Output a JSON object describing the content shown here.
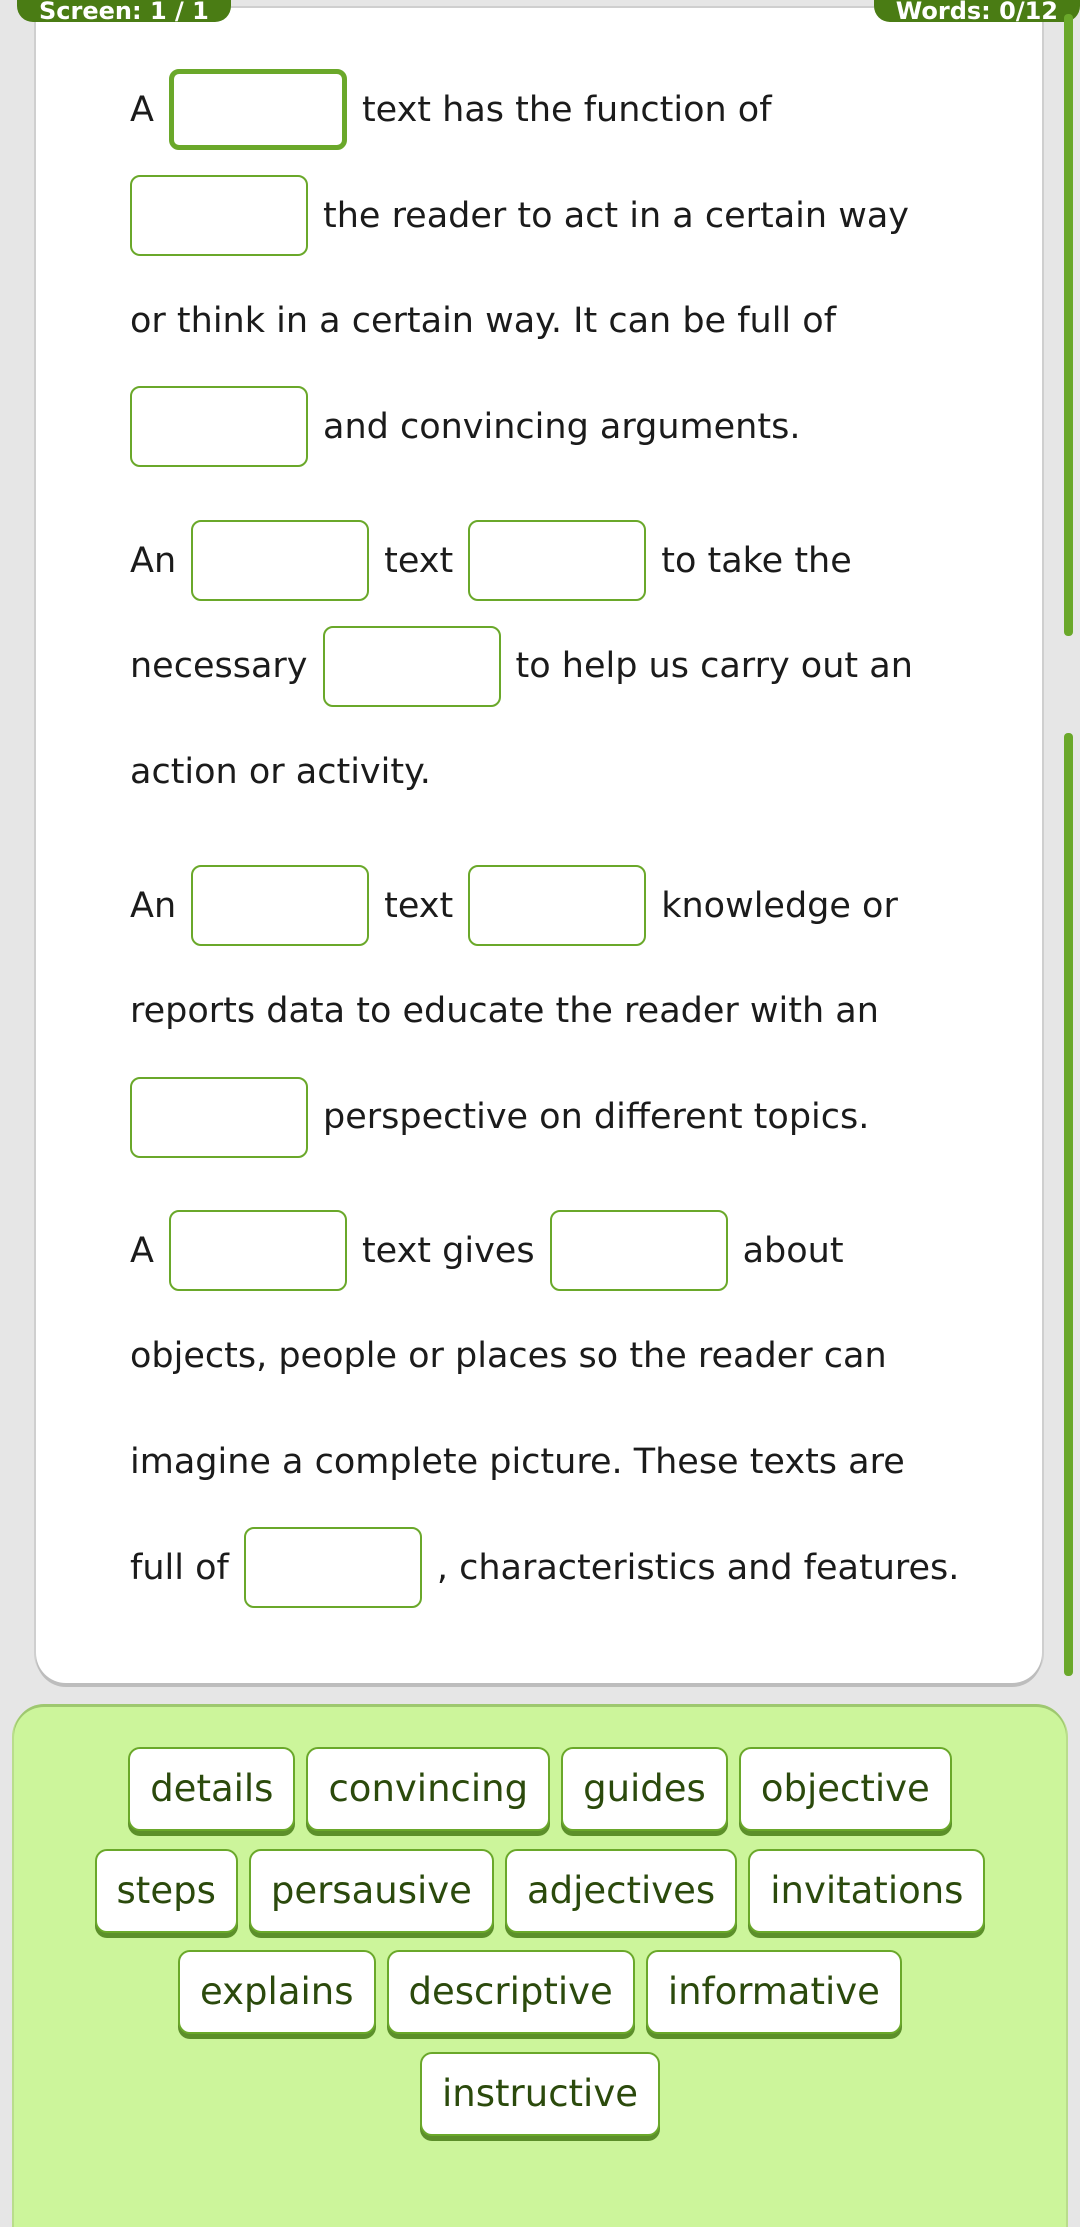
{
  "header": {
    "screen_label": "Screen: 1 / 1",
    "words_label": "Words: 0/12"
  },
  "passage": {
    "lines": [
      {
        "gap": false,
        "segs": [
          {
            "t": "A"
          },
          {
            "blank": true,
            "active": true
          },
          {
            "t": "text has the function of"
          }
        ]
      },
      {
        "gap": false,
        "segs": [
          {
            "blank": true
          },
          {
            "t": "the reader to act in a certain way"
          }
        ]
      },
      {
        "gap": false,
        "segs": [
          {
            "t": "or think in a certain way. It can be full of"
          }
        ]
      },
      {
        "gap": false,
        "segs": [
          {
            "blank": true
          },
          {
            "t": "and convincing arguments."
          }
        ]
      },
      {
        "gap": true,
        "segs": [
          {
            "t": "An"
          },
          {
            "blank": true
          },
          {
            "t": "text"
          },
          {
            "blank": true
          },
          {
            "t": "to take the"
          }
        ]
      },
      {
        "gap": false,
        "segs": [
          {
            "t": "necessary"
          },
          {
            "blank": true
          },
          {
            "t": "to help us carry out an"
          }
        ]
      },
      {
        "gap": false,
        "segs": [
          {
            "t": "action or activity."
          }
        ]
      },
      {
        "gap": true,
        "segs": [
          {
            "t": "An"
          },
          {
            "blank": true
          },
          {
            "t": "text"
          },
          {
            "blank": true
          },
          {
            "t": "knowledge or"
          }
        ]
      },
      {
        "gap": false,
        "segs": [
          {
            "t": "reports data to educate the reader with an"
          }
        ]
      },
      {
        "gap": false,
        "segs": [
          {
            "blank": true
          },
          {
            "t": "perspective on different topics."
          }
        ]
      },
      {
        "gap": true,
        "segs": [
          {
            "t": "A"
          },
          {
            "blank": true
          },
          {
            "t": "text gives"
          },
          {
            "blank": true
          },
          {
            "t": "about"
          }
        ]
      },
      {
        "gap": false,
        "segs": [
          {
            "t": "objects, people or places so the reader can"
          }
        ]
      },
      {
        "gap": false,
        "segs": [
          {
            "t": "imagine a complete picture. These texts are"
          }
        ]
      },
      {
        "gap": false,
        "segs": [
          {
            "t": "full of"
          },
          {
            "blank": true
          },
          {
            "t": ", characteristics and features."
          }
        ]
      }
    ]
  },
  "word_bank": {
    "rows": [
      [
        "details",
        "convincing",
        "guides",
        "objective"
      ],
      [
        "steps",
        "persausive",
        "adjectives",
        "invitations"
      ],
      [
        "explains",
        "descriptive",
        "informative"
      ],
      [
        "instructive"
      ]
    ]
  },
  "colors": {
    "accent": "#6aa82a",
    "badge": "#4a7c14",
    "bank_bg": "#ccf59b",
    "chip_text": "#2b4a0c"
  }
}
